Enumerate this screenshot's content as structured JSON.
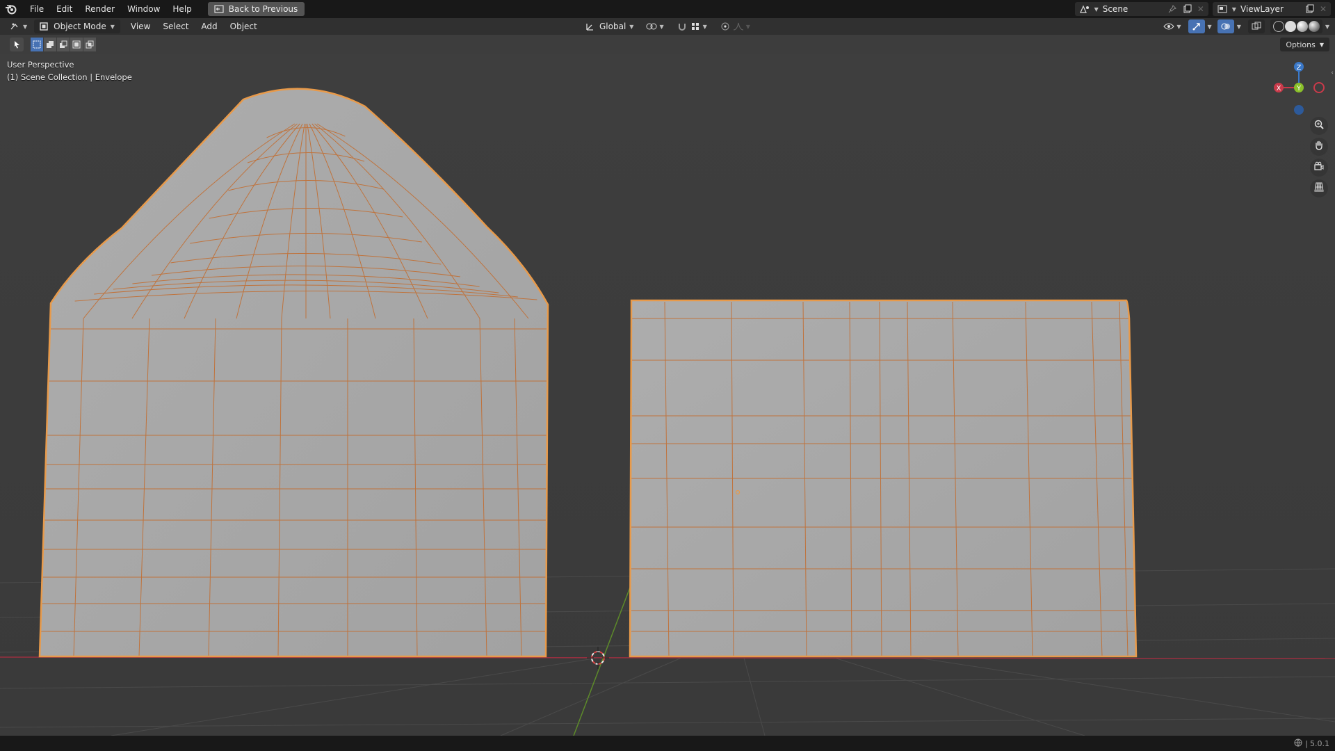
{
  "topbar": {
    "menus": [
      "File",
      "Edit",
      "Render",
      "Window",
      "Help"
    ],
    "back_label": "Back to Previous",
    "scene_name": "Scene",
    "view_layer": "ViewLayer"
  },
  "header": {
    "mode": "Object Mode",
    "menus": [
      "View",
      "Select",
      "Add",
      "Object"
    ],
    "orientation": "Global"
  },
  "toolrow": {
    "options_label": "Options"
  },
  "viewport": {
    "perspective": "User Perspective",
    "collection": "(1) Scene Collection | Envelope",
    "axes": [
      "X",
      "Y",
      "Z"
    ],
    "accent": "#e89a4a",
    "x_axis_color": "#cc3344",
    "y_axis_color": "#6a9a2a"
  },
  "status": {
    "version": "5.0.1"
  }
}
